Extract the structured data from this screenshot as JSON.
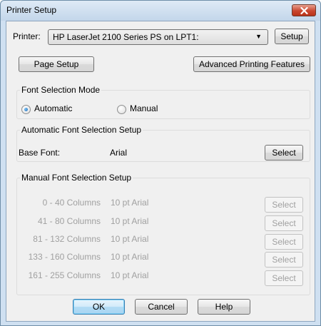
{
  "window": {
    "title": "Printer Setup"
  },
  "printer": {
    "label": "Printer:",
    "selected": "HP LaserJet 2100 Series PS on LPT1:",
    "setup_button": "Setup"
  },
  "buttons": {
    "page_setup": "Page Setup",
    "advanced": "Advanced Printing Features",
    "ok": "OK",
    "cancel": "Cancel",
    "help": "Help"
  },
  "font_mode": {
    "legend": "Font Selection Mode",
    "automatic": "Automatic",
    "manual": "Manual",
    "selected": "Automatic"
  },
  "auto_setup": {
    "legend": "Automatic Font Selection Setup",
    "base_font_label": "Base Font:",
    "base_font_value": "Arial",
    "select_button": "Select"
  },
  "manual_setup": {
    "legend": "Manual Font Selection Setup",
    "rows": [
      {
        "columns": "0 - 40 Columns",
        "font": "10 pt Arial",
        "button": "Select"
      },
      {
        "columns": "41 - 80 Columns",
        "font": "10 pt Arial",
        "button": "Select"
      },
      {
        "columns": "81 - 132 Columns",
        "font": "10 pt Arial",
        "button": "Select"
      },
      {
        "columns": "133 - 160 Columns",
        "font": "10 pt Arial",
        "button": "Select"
      },
      {
        "columns": "161 - 255 Columns",
        "font": "10 pt Arial",
        "button": "Select"
      }
    ]
  },
  "colors": {
    "title_bar": "#cfe0f1",
    "close_button": "#c9472f",
    "disabled_text": "#a0a0a0"
  }
}
